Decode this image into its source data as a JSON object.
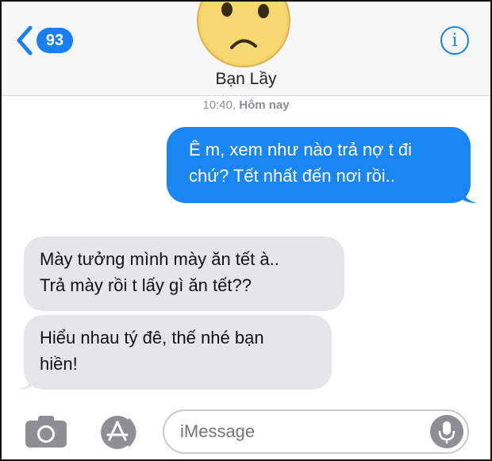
{
  "header": {
    "back_badge": "93",
    "info_symbol": "i",
    "contact_name": "Bạn Lầy"
  },
  "conversation": {
    "timestamp_time": "10:40,",
    "timestamp_day": "Hôm nay",
    "messages": [
      {
        "direction": "outgoing",
        "line1": "Ê m, xem như nào trả nợ t đi",
        "line2": "chứ? Tết nhất đến nơi rồi.."
      },
      {
        "direction": "incoming",
        "line1": "Mày tưởng mình mày ăn tết à..",
        "line2": "Trả mày rồi t lấy gì ăn tết??"
      },
      {
        "direction": "incoming",
        "line1": "Hiểu nhau tý đê, thế nhé bạn",
        "line2": "hiền!"
      }
    ]
  },
  "composer": {
    "placeholder": "iMessage"
  },
  "colors": {
    "accent": "#1a7ff0",
    "outgoing_bubble": "#1a86f3",
    "incoming_bubble": "#e6e5ea",
    "avatar_yellow": "#f5d36a"
  },
  "icons": {
    "back": "chevron-left-icon",
    "info": "info-icon",
    "camera": "camera-icon",
    "apps": "app-store-icon",
    "mic": "microphone-icon"
  }
}
